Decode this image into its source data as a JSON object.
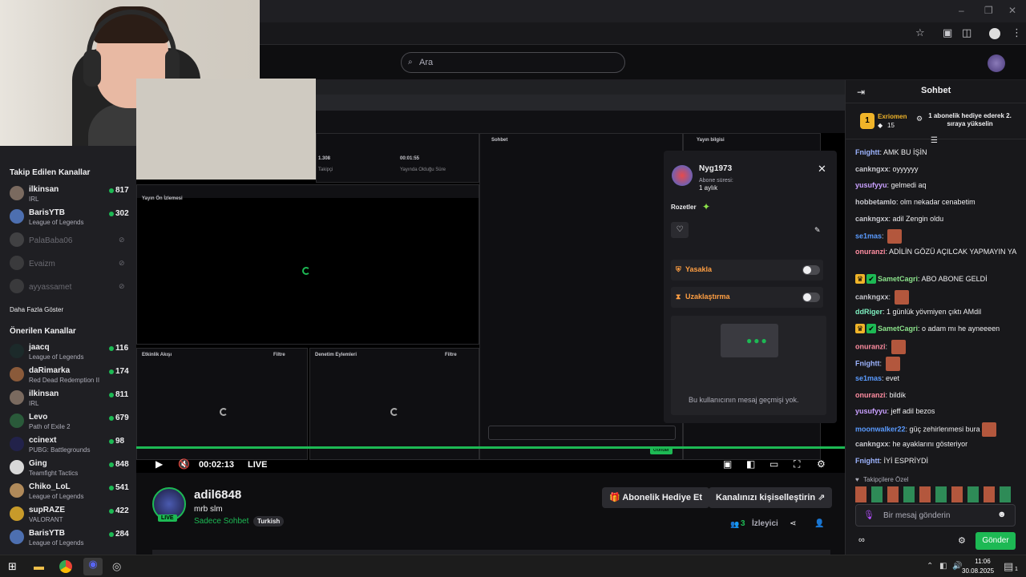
{
  "browser": {
    "window_controls": [
      "–",
      "❐",
      "✕"
    ],
    "icons": [
      "star-icon",
      "screenshot-icon",
      "extensions-icon",
      "profile-icon",
      "menu-icon"
    ]
  },
  "site": {
    "search_placeholder": "Ara"
  },
  "sidebar": {
    "followed_header": "Takip Edilen Kanallar",
    "followed": [
      {
        "name": "ilkinsan",
        "game": "IRL",
        "viewers": "817",
        "live": true,
        "color": "#7a6a5f"
      },
      {
        "name": "BarisYTB",
        "game": "League of Legends",
        "viewers": "302",
        "live": true,
        "color": "#4d6fb0"
      },
      {
        "name": "PalaBaba06",
        "game": "",
        "viewers": "",
        "live": false,
        "color": "#6a6a6a"
      },
      {
        "name": "Evaizm",
        "game": "",
        "viewers": "",
        "live": false,
        "color": "#5a5a5a"
      },
      {
        "name": "ayyassamet",
        "game": "",
        "viewers": "",
        "live": false,
        "color": "#5a5a5a"
      }
    ],
    "show_more": "Daha Fazla Göster",
    "recommended_header": "Önerilen Kanallar",
    "recommended": [
      {
        "name": "jaacq",
        "game": "League of Legends",
        "viewers": "116",
        "color": "#1c2a2a"
      },
      {
        "name": "daRimarka",
        "game": "Red Dead Redemption II",
        "viewers": "174",
        "color": "#8a5a3a"
      },
      {
        "name": "ilkinsan",
        "game": "IRL",
        "viewers": "811",
        "color": "#7a6a5f"
      },
      {
        "name": "Levo",
        "game": "Path of Exile 2",
        "viewers": "679",
        "color": "#2a5a3a"
      },
      {
        "name": "ccinext",
        "game": "PUBG: Battlegrounds",
        "viewers": "98",
        "color": "#22224a"
      },
      {
        "name": "Ging",
        "game": "Teamfight Tactics",
        "viewers": "848",
        "color": "#d8d8d8"
      },
      {
        "name": "Chiko_LoL",
        "game": "League of Legends",
        "viewers": "541",
        "color": "#b08a5a"
      },
      {
        "name": "supRAZE",
        "game": "VALORANT",
        "viewers": "422",
        "color": "#c79a2a"
      },
      {
        "name": "BarisYTB",
        "game": "League of Legends",
        "viewers": "284",
        "color": "#4d6fb0"
      }
    ]
  },
  "player": {
    "time": "00:02:13",
    "live_label": "LIVE",
    "inner": {
      "stat1": "1.308",
      "stat1_label": "Takipçi",
      "stat2": "00:01:55",
      "stat2_label": "Yayında Olduğu Süre",
      "preview_label": "Yayın Ön İzlemesi",
      "activity_label": "Etkinlik Akışı",
      "mod_label": "Denetim Eylemleri",
      "filter": "Filtre",
      "chat_label": "Sohbet",
      "stream_info_label": "Yayın bilgisi",
      "send_small": "Gönder"
    },
    "usercard": {
      "username": "Nyg1973",
      "sub_label": "Abone süresi:",
      "sub_value": "1 aylık",
      "badges_label": "Rozetler",
      "ban_label": "Yasakla",
      "timeout_label": "Uzaklaştırma",
      "no_history": "Bu kullanıcının mesaj geçmişi yok."
    }
  },
  "stream": {
    "channel": "adil6848",
    "title": "mrb slm",
    "mode": "Sadece Sohbet",
    "tag": "Turkish",
    "live_badge": "LIVE",
    "gift_button": "Abonelik Hediye Et",
    "customize_button": "Kanalınızı kişiselleştirin",
    "viewers_count": "3",
    "viewers_label": "İzleyici"
  },
  "chat": {
    "title": "Sohbet",
    "leader": {
      "rank": "1",
      "name": "Exriomen",
      "count": "15",
      "text": "1 abonelik hediye ederek 2. sıraya yükselin"
    },
    "messages": [
      {
        "user": "Fnightt",
        "color": "#9db4ff",
        "text": "AMK BU İŞİN",
        "badges": 0,
        "emote": false
      },
      {
        "user": "cankngxx",
        "color": "#c9c9cf",
        "text": "oyyyyyy",
        "badges": 0,
        "emote": false
      },
      {
        "user": "yusufyyu",
        "color": "#c9a0ff",
        "text": "gelmedi aq",
        "badges": 0,
        "emote": false
      },
      {
        "user": "hobbetamlo",
        "color": "#c9c9cf",
        "text": "olm nekadar cenabetim",
        "badges": 0,
        "emote": false
      },
      {
        "user": "cankngxx",
        "color": "#c9c9cf",
        "text": "adil Zengin oldu",
        "badges": 0,
        "emote": false
      },
      {
        "user": "se1mas",
        "color": "#5a9bff",
        "text": "",
        "badges": 0,
        "emote": true
      },
      {
        "user": "onuranzi",
        "color": "#ff8da1",
        "text": "ADİLİN GÖZÜ AÇILCAK YAPMAYIN YA",
        "badges": 0,
        "emote": false
      },
      {
        "user": "SametCagri",
        "color": "#8be28b",
        "text": "ABO ABONE GELDİ",
        "badges": 2,
        "emote": false
      },
      {
        "user": "cankngxx",
        "color": "#c9c9cf",
        "text": "",
        "badges": 0,
        "emote": true
      },
      {
        "user": "ddRiger",
        "color": "#7ef0c0",
        "text": "1 günlük yövmiyen çıktı AMdil",
        "badges": 0,
        "emote": false
      },
      {
        "user": "SametCagri",
        "color": "#8be28b",
        "text": "o adam mı he ayneeeen",
        "badges": 2,
        "emote": false
      },
      {
        "user": "onuranzi",
        "color": "#ff8da1",
        "text": "",
        "badges": 0,
        "emote": true
      },
      {
        "user": "Fnightt",
        "color": "#9db4ff",
        "text": "",
        "badges": 0,
        "emote": true
      },
      {
        "user": "se1mas",
        "color": "#5a9bff",
        "text": "evet",
        "badges": 0,
        "emote": false
      },
      {
        "user": "onuranzi",
        "color": "#ff8da1",
        "text": "bildik",
        "badges": 0,
        "emote": false
      },
      {
        "user": "yusufyyu",
        "color": "#c9a0ff",
        "text": "jeff adil bezos",
        "badges": 0,
        "emote": false
      },
      {
        "user": "moonwalker22",
        "color": "#5a9bff",
        "text": "güç zehirlenmesi bura",
        "badges": 0,
        "emote": true
      },
      {
        "user": "cankngxx",
        "color": "#c9c9cf",
        "text": "he ayaklarını gösteriyor",
        "badges": 0,
        "emote": false
      },
      {
        "user": "Fnightt",
        "color": "#9db4ff",
        "text": "İYİ ESPRİYDİ",
        "badges": 0,
        "emote": false
      }
    ],
    "followers_only": "Takipçilere Özel",
    "input_placeholder": "Bir mesaj gönderin",
    "send_button": "Gönder"
  },
  "taskbar": {
    "time": "11:06",
    "date": "30.08.2025",
    "notif_count": "1"
  },
  "colors": {
    "accent": "#1db954",
    "background": "#0e0e10",
    "panel": "#18181b"
  }
}
